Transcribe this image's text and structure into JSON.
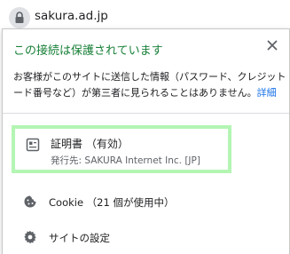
{
  "address_bar": {
    "url": "sakura.ad.jp",
    "icon": "lock-icon"
  },
  "popup": {
    "title": "この接続は保護されています",
    "description_lines": [
      "お客様がこのサイトに送信した情報（パスワード、クレジット カ",
      "ード番号など）が第三者に見られることはありません。"
    ],
    "details_link": "詳細",
    "close_icon": "close-icon",
    "certificate": {
      "title": "証明書 （有効）",
      "issuer": "発行先: SAKURA Internet Inc. [JP]",
      "icon": "certificate-icon"
    },
    "cookie": {
      "label": "Cookie （21 個が使用中）",
      "icon": "cookie-icon"
    },
    "site_settings": {
      "label": "サイトの設定",
      "icon": "gear-icon"
    }
  },
  "colors": {
    "secure_green": "#188038",
    "link_blue": "#1a73e8",
    "highlight": "#b4f5b4"
  }
}
